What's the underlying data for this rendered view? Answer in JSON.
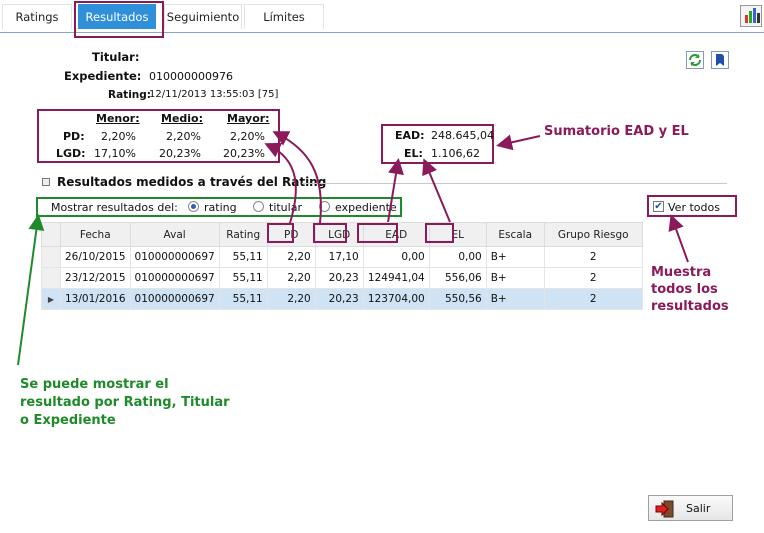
{
  "tabs": [
    {
      "label": "Ratings"
    },
    {
      "label": "Resultados"
    },
    {
      "label": "Seguimiento"
    },
    {
      "label": "Límites"
    }
  ],
  "info": {
    "titular_label": "Titular:",
    "expediente_label": "Expediente:",
    "expediente_value": "010000000976",
    "rating_label": "Rating:",
    "rating_value": "12/11/2013 13:55:03 [75]"
  },
  "summary": {
    "col_menor": "Menor:",
    "col_medio": "Medio:",
    "col_mayor": "Mayor:",
    "pd_label": "PD:",
    "pd_menor": "2,20%",
    "pd_medio": "2,20%",
    "pd_mayor": "2,20%",
    "lgd_label": "LGD:",
    "lgd_menor": "17,10%",
    "lgd_medio": "20,23%",
    "lgd_mayor": "20,23%",
    "ead_label": "EAD:",
    "ead_value": "248.645,04",
    "el_label": "EL:",
    "el_value": "1.106,62"
  },
  "section_title": "Resultados medidos a través del Rating",
  "filter": {
    "label": "Mostrar resultados del:",
    "options": [
      "rating",
      "titular",
      "expediente"
    ],
    "selected": "rating",
    "ver_todos_label": "Ver todos",
    "ver_todos_checked": true
  },
  "table": {
    "columns": [
      "Fecha",
      "Aval",
      "Rating",
      "PD",
      "LGD",
      "EAD",
      "EL",
      "Escala",
      "Grupo Riesgo"
    ],
    "rows": [
      [
        "26/10/2015",
        "010000000697",
        "55,11",
        "2,20",
        "17,10",
        "0,00",
        "0,00",
        "B+",
        "2"
      ],
      [
        "23/12/2015",
        "010000000697",
        "55,11",
        "2,20",
        "20,23",
        "124941,04",
        "556,06",
        "B+",
        "2"
      ],
      [
        "13/01/2016",
        "010000000697",
        "55,11",
        "2,20",
        "20,23",
        "123704,00",
        "550,56",
        "B+",
        "2"
      ]
    ],
    "selected_row": 2
  },
  "buttons": {
    "salir": "Salir"
  },
  "annotations": {
    "sumatorio": "Sumatorio EAD y EL",
    "muestra": [
      "Muestra",
      "todos los",
      "resultados"
    ],
    "se_puede": [
      "Se puede mostrar el",
      "resultado por Rating, Titular",
      "o Expediente"
    ]
  },
  "colors": {
    "accent_tab": "#2f8fd8",
    "annotation": "#8b1a5a",
    "annotation_green": "#1f8a2a",
    "selected_row": "#cfe3f4"
  }
}
